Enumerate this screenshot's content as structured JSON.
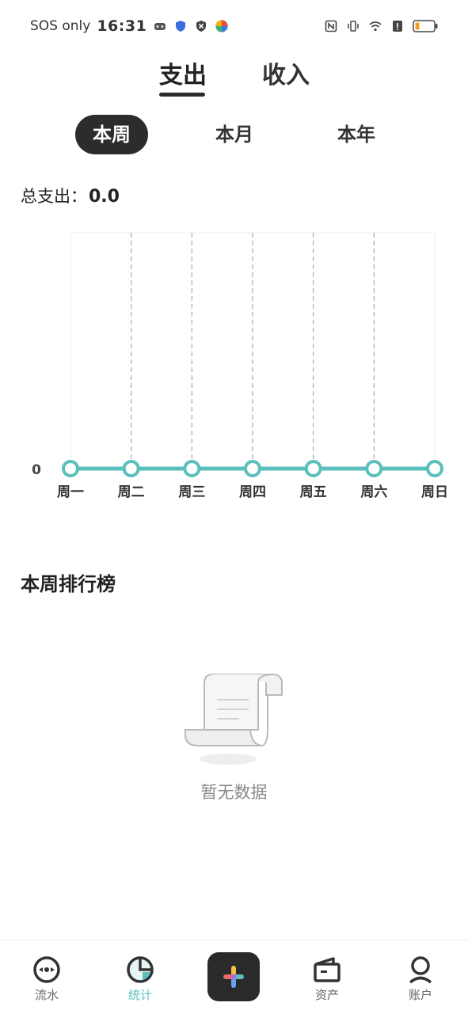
{
  "status_bar": {
    "carrier": "SOS only",
    "time": "16:31",
    "icons": [
      "gamepad-icon",
      "shield-icon",
      "close-shield-icon",
      "color-ball-icon",
      "nfc-icon",
      "vibrate-icon",
      "wifi-icon",
      "alert-icon",
      "battery-icon"
    ]
  },
  "type_tabs": [
    {
      "label": "支出",
      "active": true
    },
    {
      "label": "收入",
      "active": false
    }
  ],
  "period_tabs": [
    {
      "label": "本周",
      "active": true
    },
    {
      "label": "本月",
      "active": false
    },
    {
      "label": "本年",
      "active": false
    }
  ],
  "summary": {
    "total_label": "总支出：",
    "total_value": "0.0"
  },
  "chart_data": {
    "type": "line",
    "categories": [
      "周一",
      "周二",
      "周三",
      "周四",
      "周五",
      "周六",
      "周日"
    ],
    "values": [
      0,
      0,
      0,
      0,
      0,
      0,
      0
    ],
    "y_tick_labels": [
      "0"
    ],
    "ylim": [
      0,
      1
    ],
    "grid": true,
    "line_color": "#5bbfbc"
  },
  "ranking": {
    "title": "本周排行榜",
    "empty_text": "暂无数据"
  },
  "bottom_nav": [
    {
      "label": "流水",
      "icon": "flow-icon",
      "active": false
    },
    {
      "label": "统计",
      "icon": "pie-chart-icon",
      "active": true
    },
    {
      "label": "",
      "icon": "plus-icon",
      "active": false
    },
    {
      "label": "资产",
      "icon": "wallet-icon",
      "active": false
    },
    {
      "label": "账户",
      "icon": "user-icon",
      "active": false
    }
  ],
  "colors": {
    "accent": "#5bbfbc",
    "dark": "#2c2c2c"
  }
}
